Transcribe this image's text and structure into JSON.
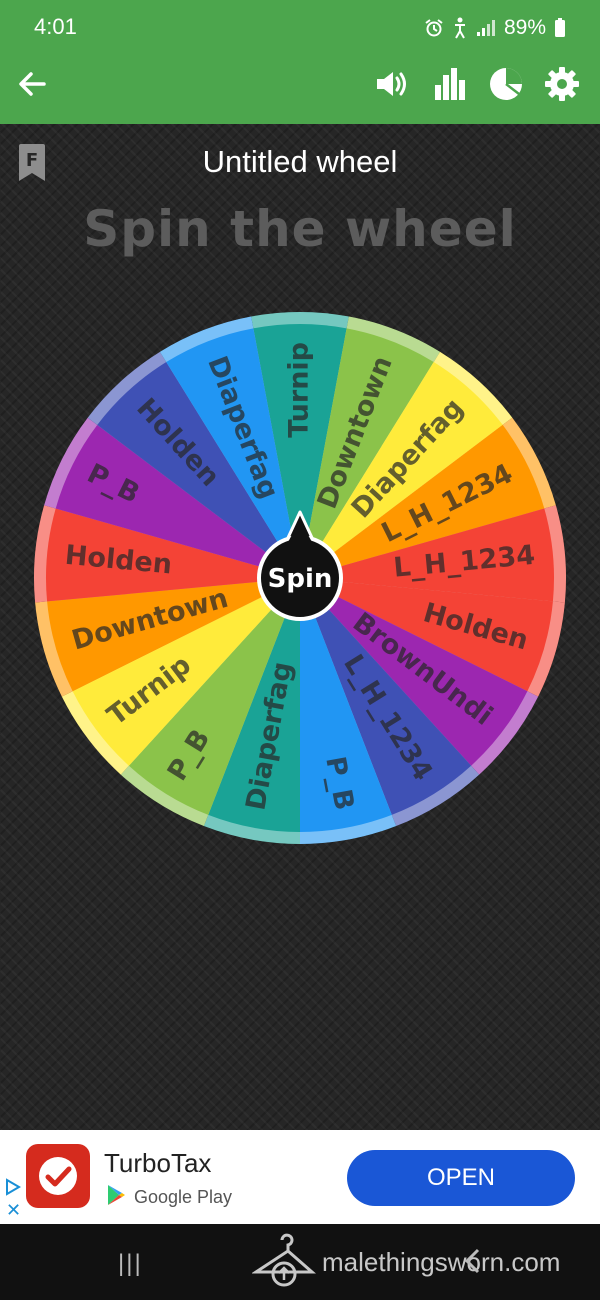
{
  "status_bar": {
    "time": "4:01",
    "battery": "89%",
    "icons": [
      "alarm-icon",
      "accessibility-icon",
      "signal-icon",
      "battery-icon"
    ]
  },
  "app_bar": {
    "background": "#4ca64d",
    "icons": [
      "back-arrow-icon",
      "volume-icon",
      "bar-chart-icon",
      "pie-chart-icon",
      "settings-gear-icon"
    ]
  },
  "wheel": {
    "title": "Untitled wheel",
    "heading": "Spin the wheel",
    "badge": "F",
    "spin_label": "Spin",
    "segments": [
      {
        "label": "Turnip",
        "color": "#1aa396"
      },
      {
        "label": "Downtown",
        "color": "#8bc34a"
      },
      {
        "label": "Diaperfag",
        "color": "#ffeb3b"
      },
      {
        "label": "L_H_1234",
        "color": "#ff9800"
      },
      {
        "label": "L_H_1234",
        "color": "#f44336"
      },
      {
        "label": "Holden",
        "color": "#f44336"
      },
      {
        "label": "BrownUndi",
        "color": "#9c27b0"
      },
      {
        "label": "L_H_1234",
        "color": "#3f51b5"
      },
      {
        "label": "P_B",
        "color": "#2196f3"
      },
      {
        "label": "Diaperfag",
        "color": "#1aa396"
      },
      {
        "label": "P_B",
        "color": "#8bc34a"
      },
      {
        "label": "Turnip",
        "color": "#ffeb3b"
      },
      {
        "label": "Downtown",
        "color": "#ff9800"
      },
      {
        "label": "Holden",
        "color": "#f44336"
      },
      {
        "label": "P_B",
        "color": "#9c27b0"
      },
      {
        "label": "Holden",
        "color": "#3f51b5"
      },
      {
        "label": "Diaperfag",
        "color": "#2196f3"
      }
    ]
  },
  "ad": {
    "app_name": "TurboTax",
    "store": "Google Play",
    "button": "OPEN",
    "close": "✕",
    "button_color": "#1a57d6"
  },
  "nav_bar": {
    "recent": "|||",
    "watermark": "malethingsworn.com"
  }
}
